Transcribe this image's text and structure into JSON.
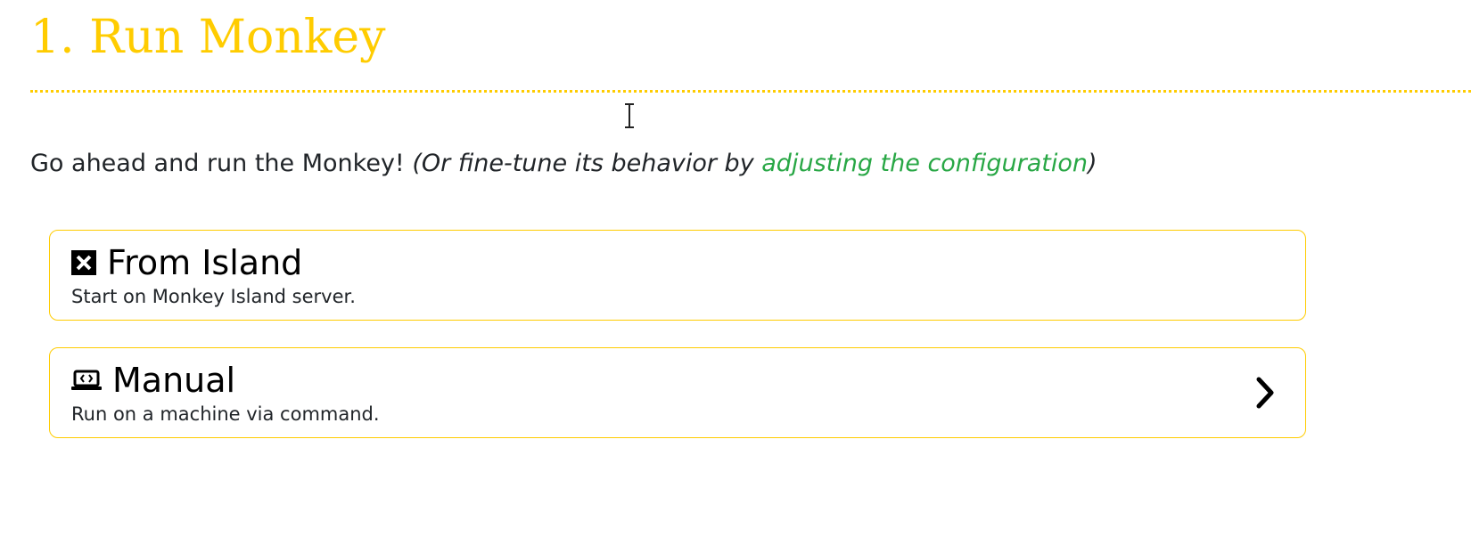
{
  "header": {
    "title": "1. Run Monkey"
  },
  "intro": {
    "text": "Go ahead and run the Monkey! ",
    "italic_prefix": "(Or fine-tune its behavior by ",
    "link_text": "adjusting the configuration",
    "italic_suffix": ")"
  },
  "options": [
    {
      "icon": "expand-arrows-icon",
      "title": "From Island",
      "description": "Start on Monkey Island server."
    },
    {
      "icon": "laptop-code-icon",
      "title": "Manual",
      "description": "Run on a machine via command."
    }
  ],
  "colors": {
    "accent": "#ffcc00",
    "link": "#28a745",
    "text": "#212529"
  }
}
